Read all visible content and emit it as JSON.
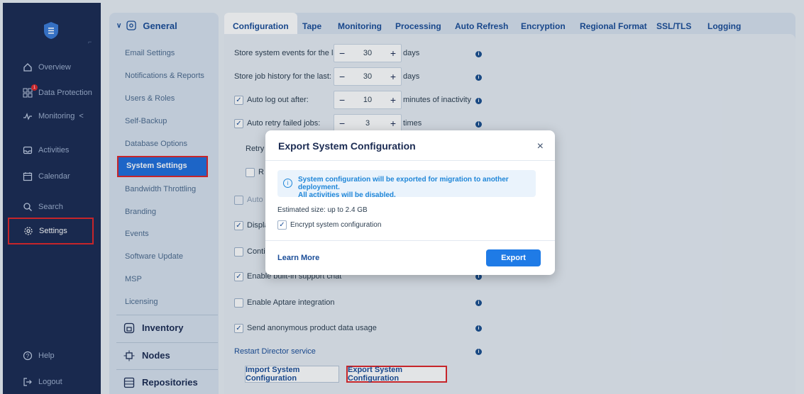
{
  "leftnav": {
    "items": [
      {
        "label": "Overview",
        "icon": "home-icon"
      },
      {
        "label": "Data Protection",
        "icon": "grid-icon",
        "badge": "1"
      },
      {
        "label": "Monitoring",
        "icon": "pulse-icon",
        "chevron": "<"
      },
      {
        "label": "Activities",
        "icon": "inbox-icon"
      },
      {
        "label": "Calendar",
        "icon": "calendar-icon"
      },
      {
        "label": "Search",
        "icon": "search-icon"
      },
      {
        "label": "Settings",
        "icon": "gear-icon"
      },
      {
        "label": "Help",
        "icon": "help-icon"
      },
      {
        "label": "Logout",
        "icon": "logout-icon"
      }
    ]
  },
  "settings_sidebar": {
    "header": "General",
    "items": [
      "Email Settings",
      "Notifications & Reports",
      "Users & Roles",
      "Self-Backup",
      "Database Options",
      "System Settings",
      "Bandwidth Throttling",
      "Branding",
      "Events",
      "Software Update",
      "MSP",
      "Licensing"
    ],
    "sections": [
      "Inventory",
      "Nodes",
      "Repositories"
    ]
  },
  "tabs": [
    "Configuration",
    "Tape",
    "Monitoring",
    "Processing",
    "Auto Refresh",
    "Encryption",
    "Regional Format",
    "SSL/TLS",
    "Logging"
  ],
  "config": {
    "store_events_label": "Store system events for the last:",
    "store_events_value": "30",
    "store_events_unit": "days",
    "store_jobs_label": "Store job history for the last:",
    "store_jobs_value": "30",
    "store_jobs_unit": "days",
    "autologout_label": "Auto log out after:",
    "autologout_value": "10",
    "autologout_unit": "minutes of inactivity",
    "autoretry_label": "Auto retry failed jobs:",
    "autoretry_value": "3",
    "autoretry_unit": "times",
    "retry_partial": "Retry i",
    "r_partial": "R",
    "autou_partial": "Auto u",
    "display_partial": "Displa",
    "contin_partial": "Contin",
    "support_chat_label": "Enable built-in support chat",
    "aptare_label": "Enable Aptare integration",
    "anon_label": "Send anonymous product data usage",
    "restart_label": "Restart Director service",
    "import_button": "Import System Configuration",
    "export_button": "Export System Configuration"
  },
  "modal": {
    "title": "Export System Configuration",
    "close": "×",
    "alert_line1": "System configuration will be exported for migration to another deployment.",
    "alert_line2": "All activities will be disabled.",
    "estimated_size": "Estimated size: up to  2.4 GB",
    "encrypt_label": "Encrypt system configuration",
    "learn_more": "Learn More",
    "export": "Export"
  }
}
